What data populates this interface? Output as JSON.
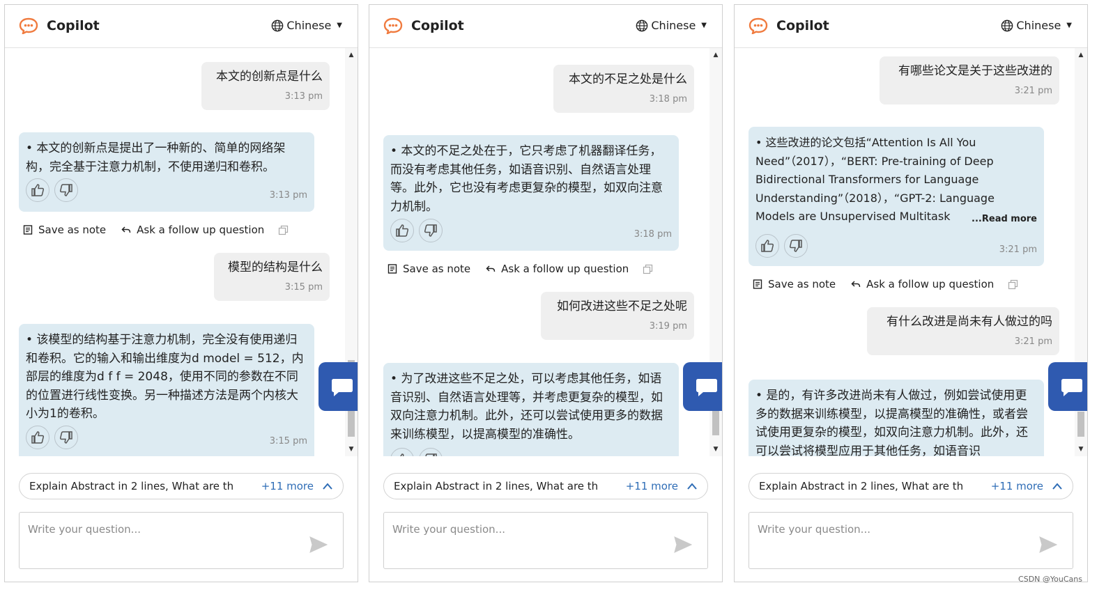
{
  "app": {
    "title": "Copilot",
    "language": "Chinese",
    "brand_color": "#f07b3f",
    "fab_color": "#2f5ab0"
  },
  "panels": [
    {
      "messages": [
        {
          "role": "user",
          "text": "本文的创新点是什么",
          "time": "3:13 pm"
        },
        {
          "role": "bot",
          "text": "• 本文的创新点是提出了一种新的、简单的网络架构，完全基于注意力机制，不使用递归和卷积。",
          "time": "3:13 pm"
        },
        {
          "role": "user",
          "text": "模型的结构是什么",
          "time": "3:15 pm"
        },
        {
          "role": "bot",
          "text": "• 该模型的结构基于注意力机制，完全没有使用递归和卷积。它的输入和输出维度为d model = 512，内部层的维度为d f f = 2048，使用不同的参数在不同的位置进行线性变换。另一种描述方法是两个内核大小为1的卷积。",
          "time": "3:15 pm"
        }
      ],
      "actions": {
        "save": "Save as note",
        "follow": "Ask a follow up question"
      }
    },
    {
      "messages": [
        {
          "role": "user",
          "text": "本文的不足之处是什么",
          "time": "3:18 pm"
        },
        {
          "role": "bot",
          "text": "• 本文的不足之处在于，它只考虑了机器翻译任务，而没有考虑其他任务，如语音识别、自然语言处理等。此外，它也没有考虑更复杂的模型，如双向注意力机制。",
          "time": "3:18 pm"
        },
        {
          "role": "user",
          "text": "如何改进这些不足之处呢",
          "time": "3:19 pm"
        },
        {
          "role": "bot",
          "text": "• 为了改进这些不足之处，可以考虑其他任务，如语音识别、自然语言处理等，并考虑更复杂的模型，如双向注意力机制。此外，还可以尝试使用更多的数据来训练模型，以提高模型的准确性。",
          "time": ""
        }
      ],
      "actions": {
        "save": "Save as note",
        "follow": "Ask a follow up question"
      }
    },
    {
      "messages": [
        {
          "role": "user",
          "text": "有哪些论文是关于这些改进的",
          "time": "3:21 pm"
        },
        {
          "role": "bot",
          "text": "• 这些改进的论文包括“Attention Is All You Need”（2017），“BERT: Pre-training of Deep Bidirectional Transformers for Language Understanding”（2018），“GPT-2: Language Models are Unsupervised Multitask",
          "time": "3:21 pm",
          "read_more": "...Read more"
        },
        {
          "role": "user",
          "text": "有什么改进是尚未有人做过的吗",
          "time": "3:21 pm"
        },
        {
          "role": "bot",
          "text": "• 是的，有许多改进尚未有人做过，例如尝试使用更多的数据来训练模型，以提高模型的准确性，或者尝试使用更复杂的模型，如双向注意力机制。此外，还可以尝试将模型应用于其他任务，如语音识",
          "time": ""
        }
      ],
      "actions": {
        "save": "Save as note",
        "follow": "Ask a follow up question"
      }
    }
  ],
  "suggestion": {
    "text": "Explain Abstract in 2 lines, What are th",
    "more": "+11 more"
  },
  "input": {
    "placeholder": "Write your question..."
  },
  "watermark": "CSDN @YouCans"
}
